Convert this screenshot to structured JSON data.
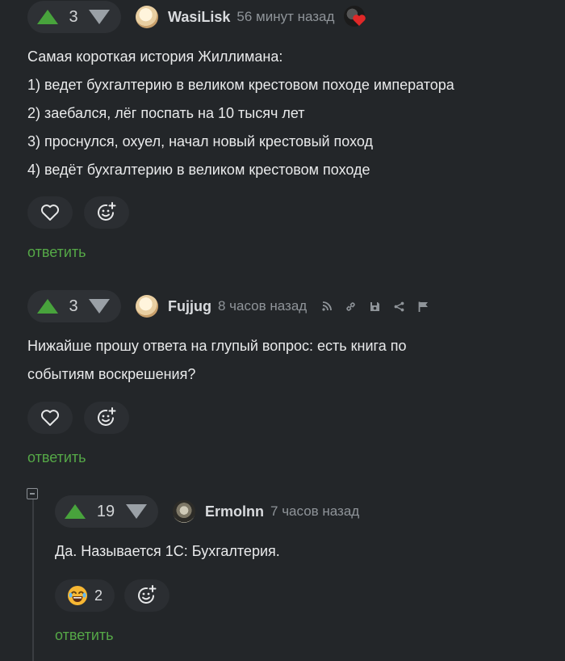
{
  "comments": [
    {
      "score": "3",
      "author": "WasiLisk",
      "time": "56 минут назад",
      "lines": [
        "Самая короткая история Жиллимана:",
        "1) ведет бухгалтерию в великом крестовом походе императора",
        "2) заебался, лёг поспать на 10 тысяч лет",
        "3) проснулся, охуел, начал новый крестовый поход",
        "4) ведёт бухгалтерию в великом крестовом походе"
      ],
      "reply": "ответить"
    },
    {
      "score": "3",
      "author": "Fujjug",
      "time": "8 часов назад",
      "lines": [
        "Нижайше прошу ответа на глупый вопрос: есть книга по",
        "событиям воскрешения?"
      ],
      "reply": "ответить"
    },
    {
      "score": "19",
      "author": "Ermolnn",
      "time": "7 часов назад",
      "lines": [
        "Да. Называется 1С: Бухгалтерия."
      ],
      "reaction_count": "2",
      "reply": "ответить"
    }
  ],
  "colors": {
    "upvote": "#48a33c",
    "reply": "#55a847",
    "background": "#232629"
  },
  "icons": [
    "upvote-icon",
    "downvote-icon",
    "heart-icon",
    "add-reaction-icon",
    "rss-icon",
    "link-icon",
    "save-icon",
    "share-icon",
    "flag-icon",
    "laughing-emoji-icon"
  ]
}
